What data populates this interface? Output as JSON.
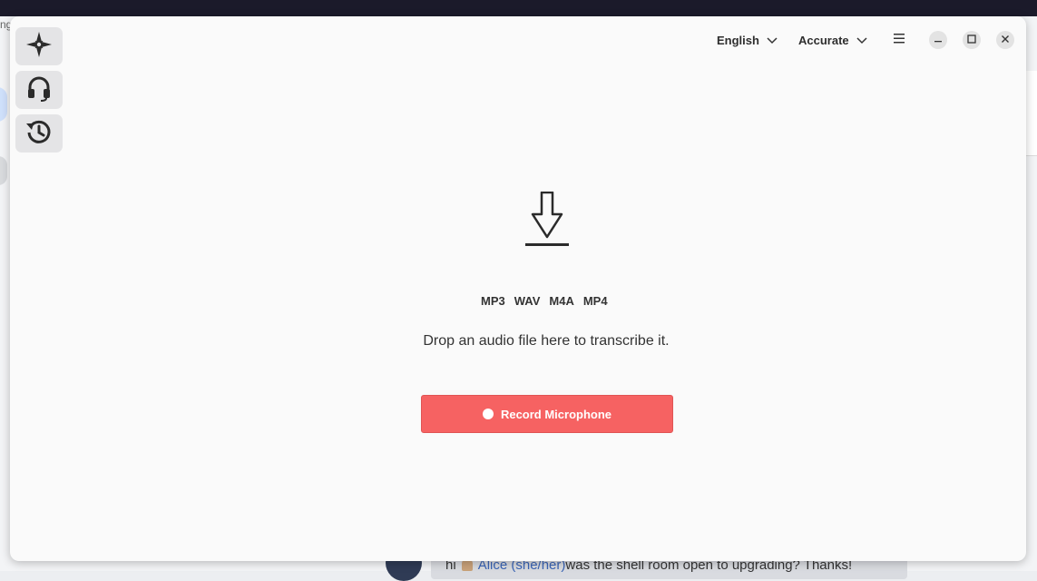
{
  "background": {
    "left_fragment": "ng",
    "chat_message": {
      "prefix": "hi",
      "mention": "Alice (she/her)",
      "text": "was the shell room open to upgrading? Thanks!"
    }
  },
  "sidebar": {
    "items": [
      {
        "name": "compass",
        "icon": "compass-icon"
      },
      {
        "name": "headphones",
        "icon": "headphones-icon"
      },
      {
        "name": "history",
        "icon": "history-icon"
      }
    ]
  },
  "header": {
    "language": "English",
    "quality": "Accurate",
    "menu_icon": "hamburger-menu-icon",
    "window_controls": [
      "minimize-icon",
      "maximize-icon",
      "close-icon"
    ]
  },
  "main": {
    "drop_icon": "download-arrow-icon",
    "formats": [
      "MP3",
      "WAV",
      "M4A",
      "MP4"
    ],
    "drop_text": "Drop an audio file here to transcribe it.",
    "record_label": "Record Microphone"
  },
  "colors": {
    "accent_record": "#f66262",
    "window_bg": "#fafafa",
    "topbar": "#1b1a2a"
  }
}
